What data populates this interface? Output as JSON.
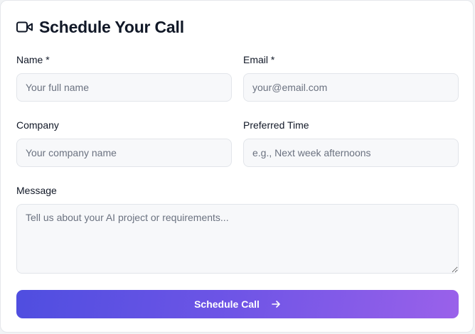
{
  "header": {
    "title": "Schedule Your Call",
    "icon": "video-camera-icon"
  },
  "form": {
    "name": {
      "label": "Name *",
      "placeholder": "Your full name",
      "value": ""
    },
    "email": {
      "label": "Email *",
      "placeholder": "your@email.com",
      "value": ""
    },
    "company": {
      "label": "Company",
      "placeholder": "Your company name",
      "value": ""
    },
    "time": {
      "label": "Preferred Time",
      "placeholder": "e.g., Next week afternoons",
      "value": ""
    },
    "message": {
      "label": "Message",
      "placeholder": "Tell us about your AI project or requirements...",
      "value": ""
    }
  },
  "submit": {
    "label": "Schedule Call",
    "icon": "arrow-right-icon"
  },
  "colors": {
    "gradient_start": "#4f4ee0",
    "gradient_end": "#9a61ea"
  }
}
